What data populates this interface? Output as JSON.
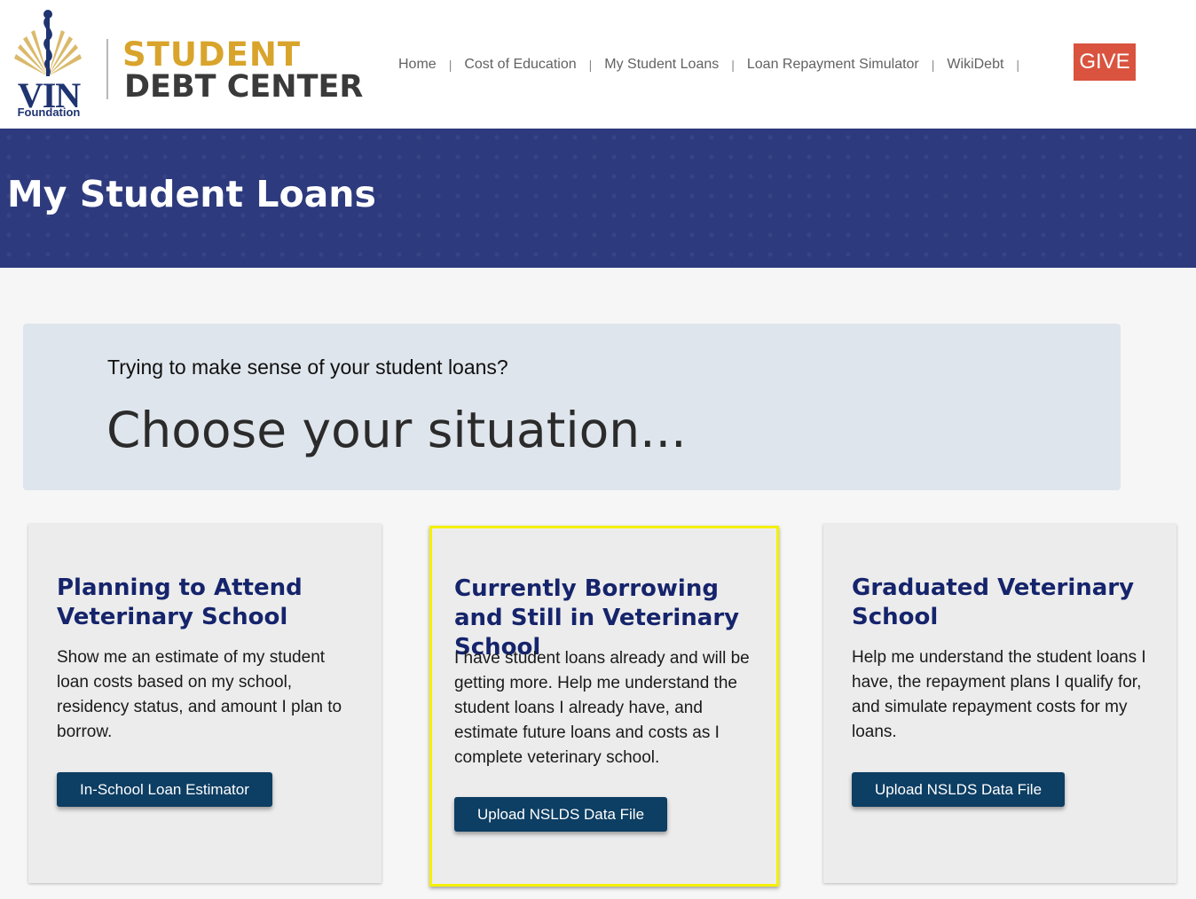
{
  "logo": {
    "org": "VIN",
    "org_sub": "Foundation",
    "title_line1": "STUDENT",
    "title_line2": "DEBT CENTER"
  },
  "nav": {
    "items": [
      "Home",
      "Cost of Education",
      "My Student Loans",
      "Loan Repayment Simulator",
      "WikiDebt"
    ],
    "separator": "|",
    "give_label": "GIVE"
  },
  "banner": {
    "title": "My Student Loans"
  },
  "intro": {
    "question": "Trying to make sense of your student loans?",
    "heading": "Choose your situation..."
  },
  "cards": [
    {
      "title": "Planning to Attend Veterinary School",
      "body": "Show me an estimate of my student loan costs based on my school, residency status, and amount I plan to borrow.",
      "button": "In-School Loan Estimator"
    },
    {
      "title": "Currently Borrowing and Still in Veterinary School",
      "body": "I have student loans already and will be getting more. Help me understand the student loans I already have, and estimate future loans and costs as I complete veterinary school.",
      "button": "Upload NSLDS Data File"
    },
    {
      "title": "Graduated Veterinary School",
      "body": "Help me understand the student loans I have, the repayment plans I qualify for, and simulate repayment costs for my loans.",
      "button": "Upload NSLDS Data File"
    }
  ],
  "colors": {
    "brand_navy": "#2d3a7d",
    "title_navy": "#15246b",
    "gold": "#d9a42c",
    "give_red": "#d9533f",
    "button_blue": "#0d3e63",
    "highlight_yellow": "#f4f000"
  }
}
